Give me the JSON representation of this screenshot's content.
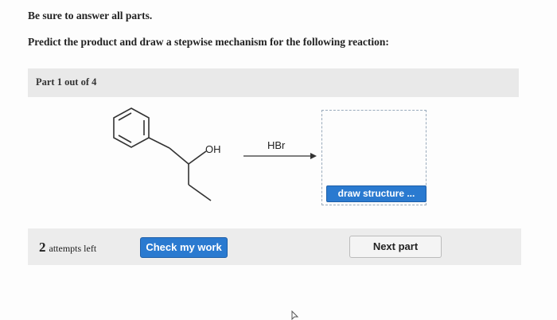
{
  "instructions": {
    "line1": "Be sure to answer all parts.",
    "line2": "Predict the product and draw a stepwise mechanism for the following reaction:"
  },
  "part": {
    "label": "Part 1 out of 4"
  },
  "reaction": {
    "reactant_label": "OH",
    "reagent": "HBr",
    "draw_button": "draw structure ..."
  },
  "footer": {
    "attempts_count": "2",
    "attempts_text": "attempts left",
    "check_button": "Check my work",
    "next_button": "Next part"
  }
}
